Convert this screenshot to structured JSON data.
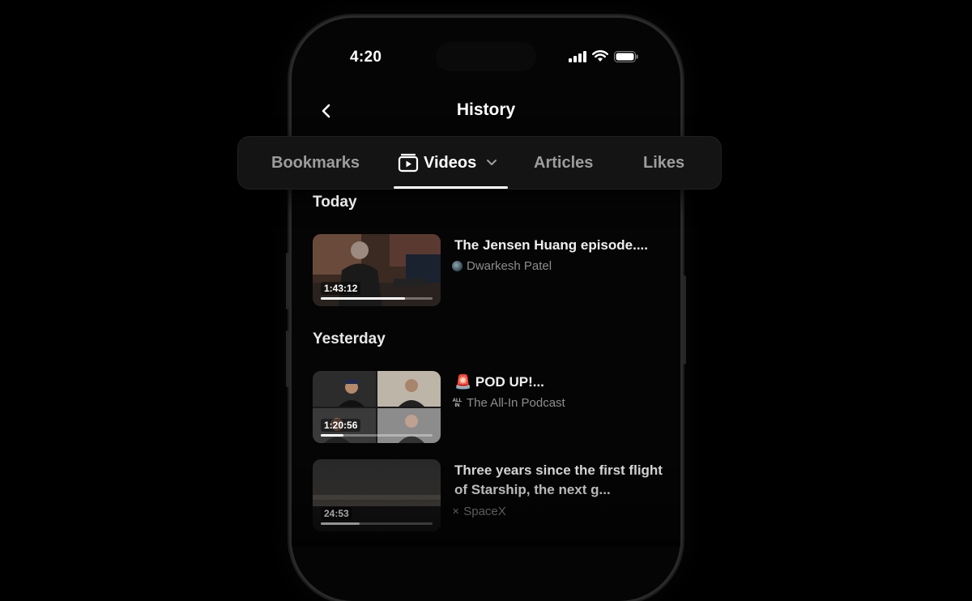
{
  "status": {
    "time": "4:20",
    "icons": [
      "cellular-signal-icon",
      "wifi-icon",
      "battery-icon"
    ]
  },
  "header": {
    "title": "History",
    "back_icon": "chevron-left-icon"
  },
  "tabs": [
    {
      "label": "Bookmarks",
      "active": false
    },
    {
      "label": "Videos",
      "active": true,
      "icon": "video-play-icon",
      "dropdown_icon": "chevron-down-icon"
    },
    {
      "label": "Articles",
      "active": false
    },
    {
      "label": "Likes",
      "active": false
    }
  ],
  "sections": [
    {
      "label": "Today",
      "videos": [
        {
          "title": "The Jensen Huang episode....",
          "channel": "Dwarkesh Patel",
          "duration": "1:43:12",
          "progress": 0.75
        }
      ]
    },
    {
      "label": "Yesterday",
      "videos": [
        {
          "title": "🚨 POD UP!...",
          "channel": "The All-In Podcast",
          "channel_icon_text": "ALL IN",
          "duration": "1:20:56",
          "progress": 0.2
        },
        {
          "title": "Three years since the first flight of Starship, the next g...",
          "channel": "SpaceX",
          "duration": "24:53",
          "progress": 0.35
        }
      ]
    }
  ],
  "colors": {
    "background": "#000000",
    "tabbar": "#141414",
    "active_tab": "#ffffff",
    "inactive_tab": "#9d9d9d",
    "secondary_text": "#8d8d8d"
  }
}
